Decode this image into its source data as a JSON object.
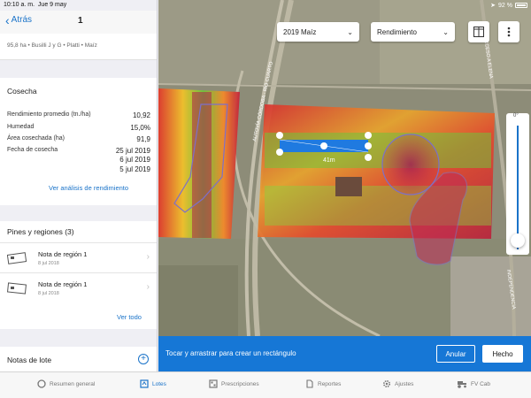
{
  "status": {
    "time": "10:10 a. m.",
    "date": "Jue 9 may",
    "battery": "92 %"
  },
  "nav": {
    "back_label": "Atrás",
    "title": "1"
  },
  "field_info": "95,8 ha • Busilli J y G • Platti • Maíz",
  "harvest": {
    "title": "Cosecha",
    "rows": [
      {
        "label": "Rendimiento promedio (tn./ha)",
        "value": "10,92"
      },
      {
        "label": "Humedad",
        "value": "15,0%"
      },
      {
        "label": "Área cosechada (ha)",
        "value": "91,9"
      },
      {
        "label": "Fecha de cosecha",
        "value": "25 jul 2019"
      }
    ],
    "extra_dates": [
      "6 jul 2019",
      "5 jul 2019"
    ],
    "link": "Ver análisis de rendimiento"
  },
  "pins": {
    "title": "Pines y regiones (3)",
    "items": [
      {
        "title": "Nota de región 1",
        "date": "8 jul 2018"
      },
      {
        "title": "Nota de región 1",
        "date": "8 jul 2018"
      }
    ],
    "see_all": "Ver todo"
  },
  "notes": {
    "title": "Notas de lote"
  },
  "map": {
    "year_select": "2019 Maíz",
    "metric_select": "Rendimiento",
    "road_label_1": "AUTOVÍA CÓRDOBA - RÍO CUARTO",
    "road_label_2": "ACCESO A ELENA",
    "road_label_3": "INDEPENDENCIA",
    "measure": "41m",
    "slider_label": "0°"
  },
  "actionbar": {
    "message": "Tocar y arrastrar para crear un rectángulo",
    "cancel": "Anular",
    "done": "Hecho"
  },
  "tabs": [
    {
      "label": "Resumen general",
      "icon": "dashboard-icon"
    },
    {
      "label": "Lotes",
      "icon": "fields-icon"
    },
    {
      "label": "Prescripciones",
      "icon": "prescriptions-icon"
    },
    {
      "label": "Reportes",
      "icon": "reports-icon"
    },
    {
      "label": "Ajustes",
      "icon": "settings-icon"
    },
    {
      "label": "FV Cab",
      "icon": "tractor-icon"
    }
  ],
  "colors": {
    "accent": "#1a73c9",
    "action_bar": "#1677d6"
  }
}
